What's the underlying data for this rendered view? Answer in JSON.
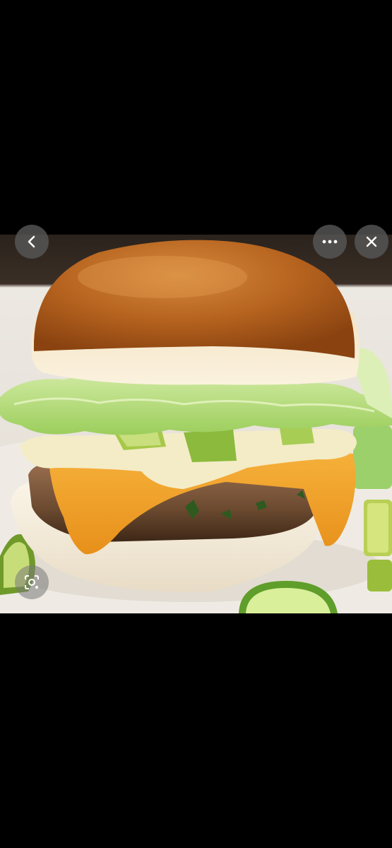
{
  "viewer": {
    "image_subject": "burger",
    "icons": {
      "back": "chevron-left-icon",
      "more": "more-horizontal-icon",
      "close": "close-icon",
      "lens": "lens-search-icon"
    },
    "colors": {
      "background": "#000000",
      "button_bg": "#5a5a5a",
      "icon": "#ffffff"
    }
  }
}
